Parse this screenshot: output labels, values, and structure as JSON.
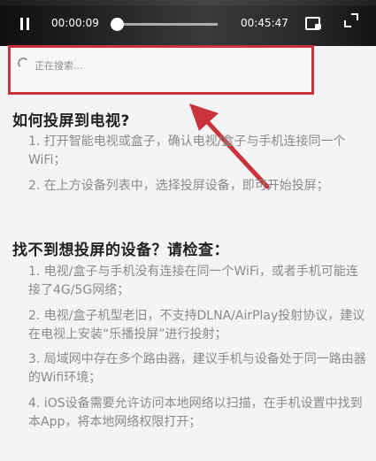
{
  "player": {
    "current_time": "00:00:09",
    "total_time": "00:45:47",
    "progress_fraction": 0.006,
    "icons": {
      "pause": "pause-icon",
      "screen_switch": "screen-switch-icon",
      "fullscreen": "fullscreen-icon"
    }
  },
  "search": {
    "status_text": "正在搜索...",
    "highlight_color": "#c8333c"
  },
  "sections": [
    {
      "heading": "如何投屏到电视?",
      "items": [
        "1. 打开智能电视或盒子，确认电视/盒子与手机连接同一个WiFi；",
        "2. 在上方设备列表中，选择投屏设备，即可开始投屏；"
      ]
    },
    {
      "heading": "找不到想投屏的设备？请检查：",
      "items": [
        "1. 电视/盒子与手机没有连接在同一个WiFi，或者手机可能连接了4G/5G网络；",
        "2. 电视/盒子机型老旧，不支持DLNA/AirPlay投射协议，建议在电视上安装“乐播投屏”进行投射；",
        "3. 局域网中存在多个路由器，建议手机与设备处于同一路由器的Wifi环境；",
        "4. iOS设备需要允许访问本地网络以扫描，在手机设置中找到本App，将本地网络权限打开；"
      ]
    }
  ],
  "colors": {
    "annotation_red": "#c8333c",
    "body_text": "#8a8a8a",
    "heading_text": "#222222"
  }
}
